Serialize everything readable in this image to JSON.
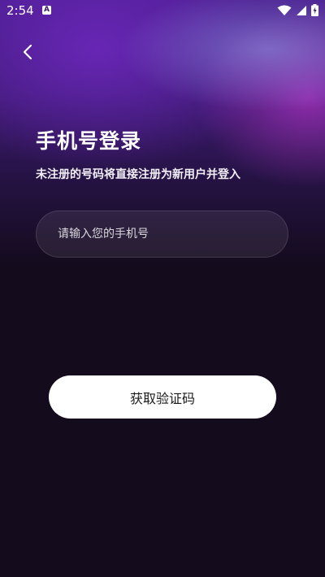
{
  "status_bar": {
    "time": "2:54",
    "app_icon_letter": "A",
    "icons": [
      "wifi-icon",
      "signal-icon",
      "battery-charging-icon"
    ]
  },
  "nav": {
    "back_icon": "chevron-left-icon"
  },
  "login": {
    "title": "手机号登录",
    "subtitle": "未注册的号码将直接注册为新用户并登入",
    "phone_placeholder": "请输入您的手机号",
    "phone_value": "",
    "get_code_label": "获取验证码"
  },
  "colors": {
    "background_dark": "#140b1c",
    "gradient_purple": "#4a1d8e",
    "button_bg": "#ffffff",
    "button_text": "#1a1a1a"
  }
}
